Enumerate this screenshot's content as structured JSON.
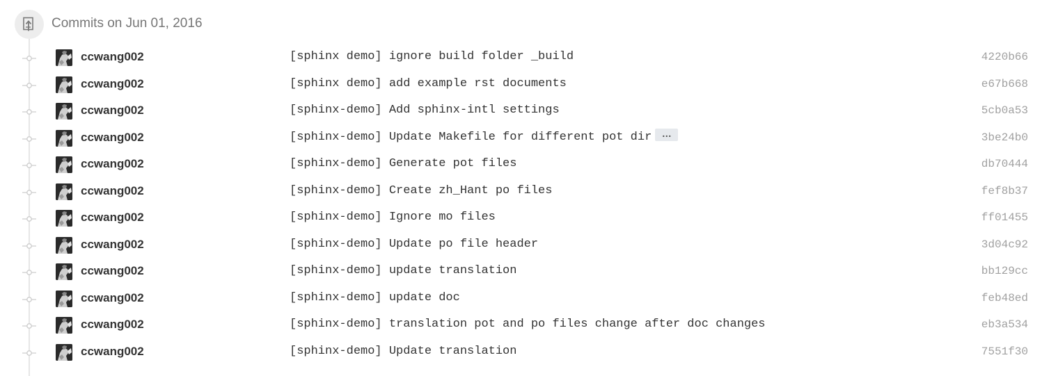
{
  "group": {
    "title": "Commits on Jun 01, 2016",
    "icon": "git-commit-push-icon"
  },
  "commits": [
    {
      "author": "ccwang002",
      "message": "[sphinx demo] ignore build folder _build",
      "sha": "4220b66",
      "truncated": false
    },
    {
      "author": "ccwang002",
      "message": "[sphinx demo] add example rst documents",
      "sha": "e67b668",
      "truncated": false
    },
    {
      "author": "ccwang002",
      "message": "[sphinx-demo] Add sphinx-intl settings",
      "sha": "5cb0a53",
      "truncated": false
    },
    {
      "author": "ccwang002",
      "message": "[sphinx-demo] Update Makefile for different pot dir",
      "sha": "3be24b0",
      "truncated": true,
      "expander_label": "…"
    },
    {
      "author": "ccwang002",
      "message": "[sphinx-demo] Generate pot files",
      "sha": "db70444",
      "truncated": false
    },
    {
      "author": "ccwang002",
      "message": "[sphinx-demo] Create zh_Hant po files",
      "sha": "fef8b37",
      "truncated": false
    },
    {
      "author": "ccwang002",
      "message": "[sphinx-demo] Ignore mo files",
      "sha": "ff01455",
      "truncated": false
    },
    {
      "author": "ccwang002",
      "message": "[sphinx-demo] Update po file header",
      "sha": "3d04c92",
      "truncated": false
    },
    {
      "author": "ccwang002",
      "message": "[sphinx-demo] update translation",
      "sha": "bb129cc",
      "truncated": false
    },
    {
      "author": "ccwang002",
      "message": "[sphinx-demo] update doc",
      "sha": "feb48ed",
      "truncated": false
    },
    {
      "author": "ccwang002",
      "message": "[sphinx-demo] translation pot and po files change after doc changes",
      "sha": "eb3a534",
      "truncated": false
    },
    {
      "author": "ccwang002",
      "message": "[sphinx-demo] Update translation",
      "sha": "7551f30",
      "truncated": false
    }
  ]
}
